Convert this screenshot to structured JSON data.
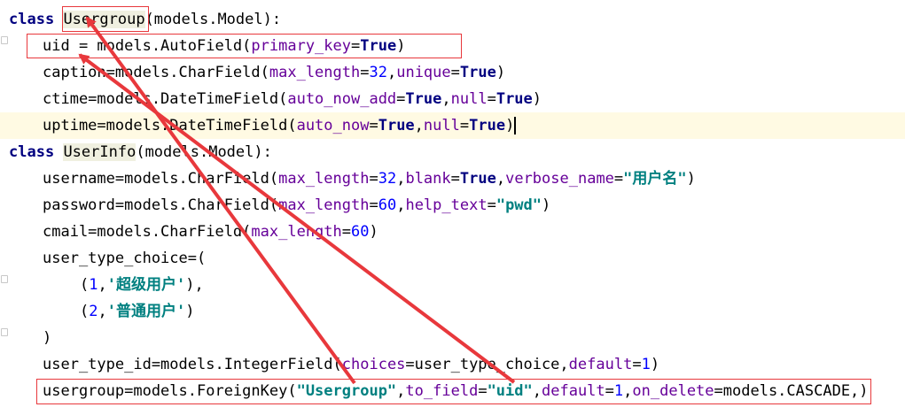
{
  "lines": [
    {
      "indent": 0,
      "tokens": [
        [
          "kw",
          "class"
        ],
        [
          "t",
          " "
        ],
        [
          "cls",
          "Usergroup"
        ],
        [
          "t",
          "(models.Model):"
        ]
      ]
    },
    {
      "indent": 1,
      "tokens": [
        [
          "t",
          "uid = models.AutoField("
        ],
        [
          "kwarg",
          "primary_key"
        ],
        [
          "t",
          "="
        ],
        [
          "bool",
          "True"
        ],
        [
          "t",
          ")"
        ]
      ]
    },
    {
      "indent": 1,
      "tokens": [
        [
          "t",
          "caption=models.CharField("
        ],
        [
          "kwarg",
          "max_length"
        ],
        [
          "t",
          "="
        ],
        [
          "num",
          "32"
        ],
        [
          "t",
          ","
        ],
        [
          "kwarg",
          "unique"
        ],
        [
          "t",
          "="
        ],
        [
          "bool",
          "True"
        ],
        [
          "t",
          ")"
        ]
      ]
    },
    {
      "indent": 1,
      "tokens": [
        [
          "t",
          "ctime=models.DateTimeField("
        ],
        [
          "kwarg",
          "auto_now_add"
        ],
        [
          "t",
          "="
        ],
        [
          "bool",
          "True"
        ],
        [
          "t",
          ","
        ],
        [
          "kwarg",
          "null"
        ],
        [
          "t",
          "="
        ],
        [
          "bool",
          "True"
        ],
        [
          "t",
          ")"
        ]
      ]
    },
    {
      "indent": 1,
      "current": true,
      "tokens": [
        [
          "t",
          "uptime=models.DateTimeField("
        ],
        [
          "kwarg",
          "auto_now"
        ],
        [
          "t",
          "="
        ],
        [
          "bool",
          "True"
        ],
        [
          "t",
          ","
        ],
        [
          "kwarg",
          "null"
        ],
        [
          "t",
          "="
        ],
        [
          "bool",
          "True"
        ],
        [
          "t",
          ")"
        ],
        [
          "caret",
          ""
        ]
      ]
    },
    {
      "indent": 0,
      "tokens": [
        [
          "kw",
          "class"
        ],
        [
          "t",
          " "
        ],
        [
          "cls",
          "UserInfo"
        ],
        [
          "t",
          "(models.Model):"
        ]
      ]
    },
    {
      "indent": 1,
      "tokens": [
        [
          "t",
          "username=models.CharField("
        ],
        [
          "kwarg",
          "max_length"
        ],
        [
          "t",
          "="
        ],
        [
          "num",
          "32"
        ],
        [
          "t",
          ","
        ],
        [
          "kwarg",
          "blank"
        ],
        [
          "t",
          "="
        ],
        [
          "bool",
          "True"
        ],
        [
          "t",
          ","
        ],
        [
          "kwarg",
          "verbose_name"
        ],
        [
          "t",
          "="
        ],
        [
          "str",
          "\"用户名\""
        ],
        [
          "t",
          ")"
        ]
      ]
    },
    {
      "indent": 1,
      "tokens": [
        [
          "t",
          "password=models.CharField("
        ],
        [
          "kwarg",
          "max_length"
        ],
        [
          "t",
          "="
        ],
        [
          "num",
          "60"
        ],
        [
          "t",
          ","
        ],
        [
          "kwarg",
          "help_text"
        ],
        [
          "t",
          "="
        ],
        [
          "str",
          "\"pwd\""
        ],
        [
          "t",
          ")"
        ]
      ]
    },
    {
      "indent": 1,
      "tokens": [
        [
          "t",
          "cmail=models.CharField("
        ],
        [
          "kwarg",
          "max_length"
        ],
        [
          "t",
          "="
        ],
        [
          "num",
          "60"
        ],
        [
          "t",
          ")"
        ]
      ]
    },
    {
      "indent": 1,
      "tokens": [
        [
          "t",
          "user_type_choice=("
        ]
      ]
    },
    {
      "indent": 2,
      "tokens": [
        [
          "t",
          "("
        ],
        [
          "num",
          "1"
        ],
        [
          "t",
          ","
        ],
        [
          "str",
          "'超级用户'"
        ],
        [
          "t",
          "),"
        ]
      ]
    },
    {
      "indent": 2,
      "tokens": [
        [
          "t",
          "("
        ],
        [
          "num",
          "2"
        ],
        [
          "t",
          ","
        ],
        [
          "str",
          "'普通用户'"
        ],
        [
          "t",
          ")"
        ]
      ]
    },
    {
      "indent": 1,
      "tokens": [
        [
          "t",
          ")"
        ]
      ]
    },
    {
      "indent": 1,
      "tokens": [
        [
          "t",
          "user_type_id=models.IntegerField("
        ],
        [
          "kwarg",
          "choices"
        ],
        [
          "t",
          "=user_type_choice,"
        ],
        [
          "kwarg",
          "default"
        ],
        [
          "t",
          "="
        ],
        [
          "num",
          "1"
        ],
        [
          "t",
          ")"
        ]
      ]
    },
    {
      "indent": 1,
      "tokens": [
        [
          "t",
          "usergroup=models.ForeignKey("
        ],
        [
          "str",
          "\"Usergroup\""
        ],
        [
          "t",
          ","
        ],
        [
          "kwarg",
          "to_field"
        ],
        [
          "t",
          "="
        ],
        [
          "str",
          "\"uid\""
        ],
        [
          "t",
          ","
        ],
        [
          "kwarg",
          "default"
        ],
        [
          "t",
          "="
        ],
        [
          "num",
          "1"
        ],
        [
          "t",
          ","
        ],
        [
          "kwarg",
          "on_delete"
        ],
        [
          "t",
          "=models.CASCADE,)"
        ]
      ]
    }
  ],
  "annotations": {
    "color": "#e8383c",
    "highlighted": [
      "Usergroup",
      "uid = models.AutoField(primary_key=True)",
      "usergroup=models.ForeignKey(\"Usergroup\",to_field=\"uid\",default=1,on_delete=models.CASCADE,)"
    ]
  }
}
